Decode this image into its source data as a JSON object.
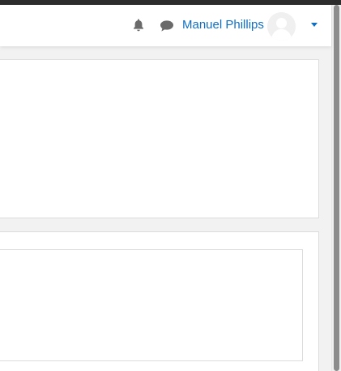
{
  "header": {
    "user_name": "Manuel Phillips",
    "icons": {
      "notifications": "bell-icon",
      "messages": "chat-icon",
      "user_menu_toggle": "caret-down-icon",
      "avatar": "default-user-avatar"
    },
    "colors": {
      "link": "#0f6fc5",
      "icon": "#6a6a6a",
      "navbar_bg": "#ffffff"
    }
  },
  "colors": {
    "page_bg": "#f2f2f2",
    "card_border": "#dcdcdc",
    "scrollbar_thumb": "#8c8c8c"
  }
}
